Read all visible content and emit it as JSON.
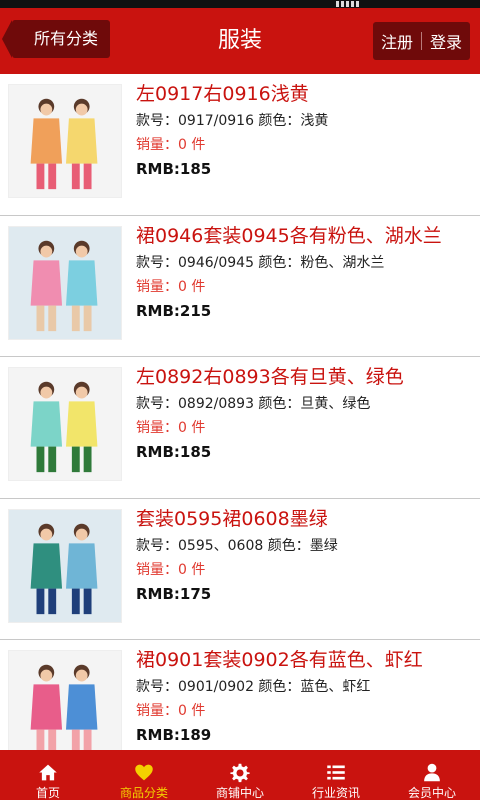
{
  "header": {
    "back_label": "所有分类",
    "title": "服装",
    "register_label": "注册",
    "login_label": "登录"
  },
  "products": [
    {
      "title": "左0917右0916浅黄",
      "meta": "款号：0917/0916 颜色：浅黄",
      "sales": "销量：0 件",
      "price": "RMB:185",
      "palette": [
        "#f0a05a",
        "#f5d76e",
        "#e85d75"
      ]
    },
    {
      "title": "裙0946套装0945各有粉色、湖水兰",
      "meta": "款号：0946/0945 颜色：粉色、湖水兰",
      "sales": "销量：0 件",
      "price": "RMB:215",
      "palette": [
        "#f08db0",
        "#7ccfe0",
        "#e9c9a8"
      ]
    },
    {
      "title": "左0892右0893各有旦黄、绿色",
      "meta": "款号：0892/0893 颜色：旦黄、绿色",
      "sales": "销量：0 件",
      "price": "RMB:185",
      "palette": [
        "#7cd4c8",
        "#f2e56a",
        "#2f7a3a"
      ]
    },
    {
      "title": "套装0595裙0608墨绿",
      "meta": "款号：0595、0608 颜色：墨绿",
      "sales": "销量：0 件",
      "price": "RMB:175",
      "palette": [
        "#2f8f7f",
        "#6fb5d6",
        "#1f3f7a"
      ]
    },
    {
      "title": "裙0901套装0902各有蓝色、虾红",
      "meta": "款号：0901/0902 颜色：蓝色、虾红",
      "sales": "销量：0 件",
      "price": "RMB:189",
      "palette": [
        "#e85d8a",
        "#4d8fd6",
        "#f2a2a8"
      ]
    }
  ],
  "tabs": [
    {
      "label": "首页",
      "icon": "home-icon",
      "active": false
    },
    {
      "label": "商品分类",
      "icon": "heart-icon",
      "active": true
    },
    {
      "label": "商铺中心",
      "icon": "gear-icon",
      "active": false
    },
    {
      "label": "行业资讯",
      "icon": "list-icon",
      "active": false
    },
    {
      "label": "会员中心",
      "icon": "user-icon",
      "active": false
    }
  ],
  "colors": {
    "brand_red": "#c9130f",
    "dark_red": "#6f0a0a",
    "active_tab": "#f4d000"
  }
}
